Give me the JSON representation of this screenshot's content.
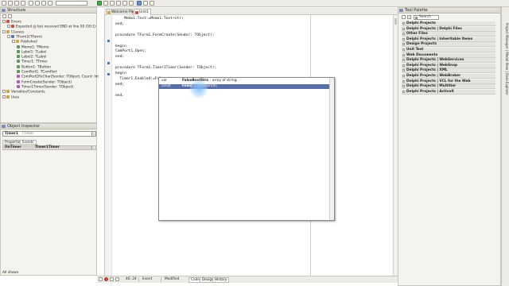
{
  "structure": {
    "title": "Structure",
    "tree": [
      {
        "label": "Errors",
        "depth": 0,
        "icon": "error-folder-icon",
        "color": "#d24b3c"
      },
      {
        "label": "Expected @ but received END at line 50 (50:1)",
        "depth": 1,
        "icon": "error-icon",
        "color": "#d24b3c"
      },
      {
        "label": "Classes",
        "depth": 0,
        "icon": "folder-icon",
        "color": "#c9a44a"
      },
      {
        "label": "TForm1(TForm)",
        "depth": 1,
        "icon": "class-icon",
        "color": "#5a79b8"
      },
      {
        "label": "Published",
        "depth": 2,
        "icon": "folder-icon",
        "color": "#c9a44a"
      },
      {
        "label": "Memo1: TMemo",
        "depth": 3,
        "icon": "field-icon",
        "color": "#5a9a5a"
      },
      {
        "label": "Label1: TLabel",
        "depth": 3,
        "icon": "field-icon",
        "color": "#5a9a5a"
      },
      {
        "label": "Label2: TLabel",
        "depth": 3,
        "icon": "field-icon",
        "color": "#5a9a5a"
      },
      {
        "label": "Timer1: TTimer",
        "depth": 3,
        "icon": "field-icon",
        "color": "#5a9a5a"
      },
      {
        "label": "Button1: TButton",
        "depth": 3,
        "icon": "field-icon",
        "color": "#5a9a5a"
      },
      {
        "label": "ComPort1: TComPort",
        "depth": 3,
        "icon": "field-icon",
        "color": "#5a9a5a"
      },
      {
        "label": "ComPort1RxChar(Sender: TObject; Count: Int",
        "depth": 3,
        "icon": "method-icon",
        "color": "#b05cc0"
      },
      {
        "label": "FormCreate(Sender: TObject)",
        "depth": 3,
        "icon": "method-icon",
        "color": "#b05cc0"
      },
      {
        "label": "Timer1Timer(Sender: TObject)",
        "depth": 3,
        "icon": "method-icon",
        "color": "#b05cc0"
      },
      {
        "label": "Variables/Constants",
        "depth": 0,
        "icon": "folder-icon",
        "color": "#c9a44a"
      },
      {
        "label": "Uses",
        "depth": 0,
        "icon": "folder-icon",
        "color": "#c9a44a"
      }
    ]
  },
  "object_inspector": {
    "title": "Object Inspector",
    "component": "Timer1",
    "component_type": "TTimer",
    "tabs": [
      "Properties",
      "Events"
    ],
    "row": {
      "name": "OnTimer",
      "value": "Timer1Timer"
    }
  },
  "editor": {
    "tabs": [
      "Welcome Page",
      "Unit1"
    ],
    "lines": [
      "    Memo1.Text:=Memo1.Text+str;",
      "end;",
      "",
      "procedure TForm1.FormCreate(Sender: TObject);",
      "",
      "begin",
      "ComPort1.Open;",
      "end;",
      "",
      "procedure TForm1.Timer1Timer(Sender: TObject);",
      "begin",
      "  Timer1.Enabled:=False",
      "end;",
      "",
      "end."
    ]
  },
  "completion": {
    "items": [
      {
        "kind": "var",
        "name": "FalseBoolStrs",
        "desc": ": array of string;",
        "selected": false
      },
      {
        "kind": "const",
        "name": "False",
        "desc": "= Boolean(0);",
        "selected": true
      }
    ]
  },
  "statusbar": {
    "position": "46: 24",
    "mode": "Insert",
    "state": "Modified",
    "tabs": [
      "Code",
      "Design",
      "History"
    ],
    "left_label": "All shown"
  },
  "tool_palette": {
    "title": "Tool Palette",
    "search_placeholder": "Search",
    "categories": [
      "Delphi Projects",
      "Delphi Projects | Delphi Files",
      "Other Files",
      "Delphi Projects | Inheritable Items",
      "Design Projects",
      "Unit Test",
      "Web Documents",
      "Delphi Projects | WebServices",
      "Delphi Projects | WebSnap",
      "Delphi Projects | XML",
      "Delphi Projects | WebBroker",
      "Delphi Projects | VCL for the Web",
      "Delphi Projects | Multitier",
      "Delphi Projects | ActiveX"
    ]
  },
  "side_tabs": {
    "label": "Project Manager | Model View | Data Explorer"
  },
  "colors": {
    "selection": "#5a6ea6",
    "accent_run": "#4aa64a"
  }
}
